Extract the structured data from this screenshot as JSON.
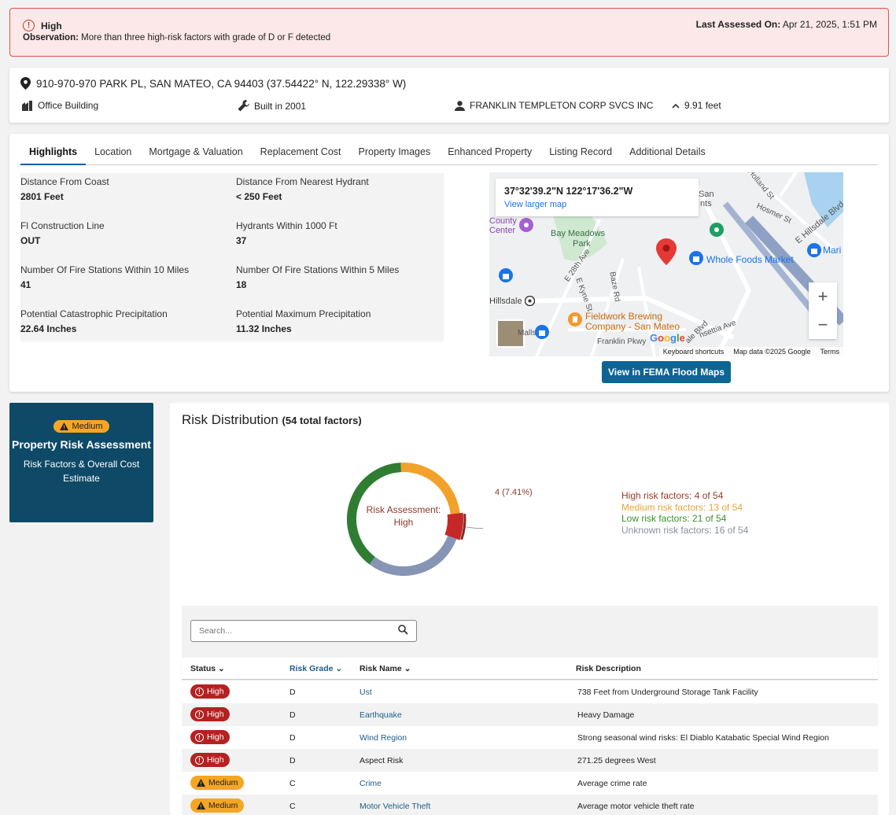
{
  "alert": {
    "level": "High",
    "observation_label": "Observation:",
    "observation_text": "More than three high-risk factors with grade of D or F detected",
    "assessed_label": "Last Assessed On:",
    "assessed_value": "Apr 21, 2025, 1:51 PM"
  },
  "property": {
    "address": "910-970-970 PARK PL, SAN MATEO, CA 94403 (37.54422° N, 122.29338° W)",
    "type": "Office Building",
    "built": "Built in 2001",
    "owner": "FRANKLIN TEMPLETON CORP SVCS INC",
    "elevation": "9.91 feet"
  },
  "tabs": [
    "Highlights",
    "Location",
    "Mortgage & Valuation",
    "Replacement Cost",
    "Property Images",
    "Enhanced Property",
    "Listing Record",
    "Additional Details"
  ],
  "facts": [
    {
      "label": "Distance From Coast",
      "value": "2801 Feet"
    },
    {
      "label": "Distance From Nearest Hydrant",
      "value": "< 250 Feet"
    },
    {
      "label": "Fl Construction Line",
      "value": "OUT"
    },
    {
      "label": "Hydrants Within 1000 Ft",
      "value": "37"
    },
    {
      "label": "Number Of Fire Stations Within 10 Miles",
      "value": "41"
    },
    {
      "label": "Number Of Fire Stations Within 5 Miles",
      "value": "18"
    },
    {
      "label": "Potential Catastrophic Precipitation",
      "value": "22.64 Inches"
    },
    {
      "label": "Potential Maximum Precipitation",
      "value": "11.32 Inches"
    }
  ],
  "map": {
    "coords": "37°32'39.2\"N 122°17'36.2\"W",
    "larger_map": "View larger map",
    "zoom_in": "+",
    "zoom_out": "−",
    "google": "Google",
    "attr_shortcuts": "Keyboard shortcuts",
    "attr_data": "Map data ©2025 Google",
    "attr_terms": "Terms",
    "labels": {
      "bay_meadows": "Bay Meadows",
      "park": "Park",
      "whole_foods": "Whole Foods Market",
      "fieldwork_1": "Fieldwork Brewing",
      "fieldwork_2": "Company - San Mateo",
      "hillsdale": "Hillsdale",
      "county": "County",
      "center": "Center",
      "hillsdale_blvd": "E Hillsdale Blvd",
      "hosmer": "Hosmer St",
      "holland": "Holland St",
      "e28": "E 28th Ave",
      "kyne": "E Kyne St",
      "baze": "Baze Rd",
      "franklin": "Franklin Pkwy",
      "concertia": "nsettia Ave",
      "mari": "Mari",
      "san": "San",
      "nts": "nts",
      "ale_blvd": "ale Blvd",
      "malls": "Malls"
    }
  },
  "fema_button": "View in FEMA Flood Maps",
  "side_card": {
    "badge": "Medium",
    "title": "Property Risk Assessment",
    "subtitle": "Risk Factors & Overall Cost Estimate"
  },
  "risk": {
    "title": "Risk Distribution",
    "total": "(54 total factors)",
    "center_label_1": "Risk Assessment:",
    "center_label_2": "High",
    "callout": "4 (7.41%)",
    "colors": {
      "high": "#c62828",
      "medium": "#f2a12a",
      "low": "#2e7d32",
      "unknown": "#8795b5"
    }
  },
  "chart_data": {
    "type": "pie",
    "title": "Risk Distribution",
    "categories": [
      "High",
      "Medium",
      "Low",
      "Unknown"
    ],
    "values": [
      4,
      13,
      21,
      16
    ],
    "legend_text": [
      "High risk factors: 4 of 54",
      "Medium risk factors: 13 of 54",
      "Low risk factors: 21 of 54",
      "Unknown risk factors: 16 of 54"
    ],
    "legend_position": "right"
  },
  "table": {
    "search_placeholder": "Search...",
    "columns": [
      "Status",
      "Risk Grade",
      "Risk Name",
      "Risk Description"
    ],
    "rows": [
      {
        "status": "High",
        "grade": "D",
        "name": "Ust",
        "desc": "738 Feet from Underground Storage Tank Facility"
      },
      {
        "status": "High",
        "grade": "D",
        "name": "Earthquake",
        "desc": "Heavy Damage"
      },
      {
        "status": "High",
        "grade": "D",
        "name": "Wind Region",
        "desc": "Strong seasonal wind risks: El Diablo Katabatic Special Wind Region"
      },
      {
        "status": "High",
        "grade": "D",
        "name": "Aspect Risk",
        "desc": "271.25 degrees West"
      },
      {
        "status": "Medium",
        "grade": "C",
        "name": "Crime",
        "desc": "Average crime rate"
      },
      {
        "status": "Medium",
        "grade": "C",
        "name": "Motor Vehicle Theft",
        "desc": "Average motor vehicle theft rate"
      }
    ]
  }
}
